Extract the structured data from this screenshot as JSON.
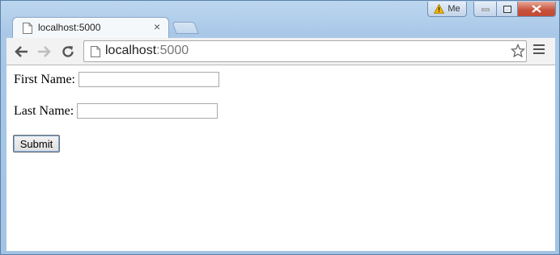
{
  "window": {
    "profile_label": "Me"
  },
  "tab": {
    "title": "localhost:5000",
    "close_glyph": "×"
  },
  "toolbar": {
    "url_host": "localhost",
    "url_port": ":5000"
  },
  "form": {
    "first_name_label": "First Name:",
    "first_name_value": "",
    "last_name_label": "Last Name:",
    "last_name_value": "",
    "submit_label": "Submit"
  },
  "colors": {
    "frame": "#a9c8e8",
    "close_button": "#c7503a",
    "warning": "#f0b400"
  }
}
